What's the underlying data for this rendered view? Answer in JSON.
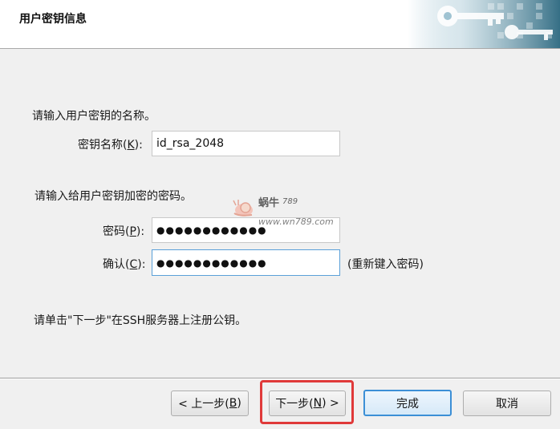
{
  "header": {
    "title": "用户密钥信息"
  },
  "name_section": {
    "prompt": "请输入用户密钥的名称。",
    "label_prefix": "密钥名称(",
    "label_key": "K",
    "label_suffix": "):",
    "value": "id_rsa_2048"
  },
  "password_section": {
    "prompt": "请输入给用户密钥加密的密码。",
    "password_label_prefix": "密码(",
    "password_label_key": "P",
    "password_label_suffix": "):",
    "password_value": "●●●●●●●●●●●●",
    "confirm_label_prefix": "确认(",
    "confirm_label_key": "C",
    "confirm_label_suffix": "):",
    "confirm_value": "●●●●●●●●●●●●",
    "confirm_hint": "(重新键入密码)"
  },
  "footer_note": "请单击\"下一步\"在SSH服务器上注册公钥。",
  "buttons": {
    "back_prefix": "< 上一步(",
    "back_key": "B",
    "back_suffix": ")",
    "next_prefix": "下一步(",
    "next_key": "N",
    "next_suffix": ") >",
    "finish": "完成",
    "cancel": "取消"
  },
  "watermark": {
    "brand": "蜗牛",
    "num": "789",
    "url": "www.wn789.com"
  },
  "colors": {
    "highlight": "#e03a3a",
    "primary_border": "#3c8fd6",
    "header_art": "#1f5f78"
  }
}
